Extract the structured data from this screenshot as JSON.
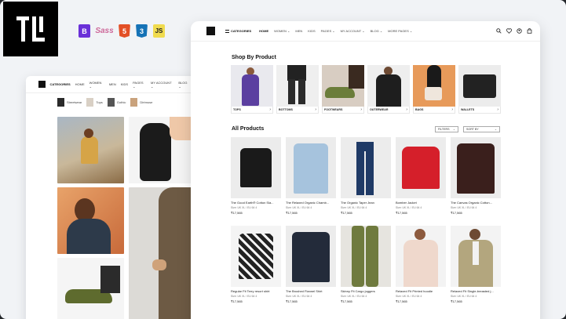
{
  "nav": {
    "categories_label": "CATEGORIES",
    "links": [
      "HOME",
      "WOMEN ⌄",
      "MEN",
      "KIDS",
      "PAGES ⌄",
      "MY ACCOUNT ⌄",
      "BLOG ⌄",
      "MORE PAGES ⌄"
    ],
    "back_links": [
      "HOME",
      "WOMEN ⌄",
      "MEN",
      "KIDS",
      "PAGES ⌄",
      "MY ACCOUNT ⌄",
      "BLOG ⌄",
      "MORE P"
    ]
  },
  "tech_badges": [
    "B",
    "Sass",
    "5",
    "3",
    "JS"
  ],
  "back_categories": [
    "Streetwear",
    "Tops",
    "Gothic",
    "Dirtmuse"
  ],
  "shop_by_product": {
    "title": "Shop By Product",
    "items": [
      {
        "label": "TOPS",
        "color": "#5b3fa0"
      },
      {
        "label": "BOTTOMS",
        "color": "#2b2b2b"
      },
      {
        "label": "FOOTWEARS",
        "color": "#6b7d3a"
      },
      {
        "label": "OUTERWEAR",
        "color": "#1e1e1e"
      },
      {
        "label": "BAGS",
        "color": "#9b5a3a"
      },
      {
        "label": "WALLETS",
        "color": "#222222"
      }
    ]
  },
  "all_products": {
    "title": "All Products",
    "filters_label": "FILTERS",
    "sort_label": "SORT BY",
    "items": [
      {
        "name": "The Good Earth® Cotton Sla...",
        "size": "Size: UK XL / EU 64 4",
        "price": "₹17,565",
        "color": "#1a1a1a"
      },
      {
        "name": "The Relaxed Organic Chamb...",
        "size": "Size: UK XL / EU 64 4",
        "price": "₹17,565",
        "color": "#a6c3dd"
      },
      {
        "name": "The Organic Taper Jean",
        "size": "Size: UK XL / EU 64 4",
        "price": "₹17,565",
        "color": "#1f3a66"
      },
      {
        "name": "Bomber Jacket",
        "size": "Size: UK XL / EU 64 4",
        "price": "₹17,565",
        "color": "#d51f2a"
      },
      {
        "name": "The Canvas Organic Cotton...",
        "size": "Size: UK XL / EU 64 4",
        "price": "₹17,565",
        "color": "#3a1f1c"
      },
      {
        "name": "Regular Fit Terry resort shirt",
        "size": "Size: UK XL / EU 64 4",
        "price": "₹17,565",
        "color": "#222222"
      },
      {
        "name": "The Brushed Flannel Shirt",
        "size": "Size: UK XL / EU 64 4",
        "price": "₹17,565",
        "color": "#232b3a"
      },
      {
        "name": "Skinny Fit Cargo joggers",
        "size": "Size: UK XL / EU 64 4",
        "price": "₹17,565",
        "color": "#6f7a3e"
      },
      {
        "name": "Relaxed Fit Printed hoodie",
        "size": "Size: UK XL / EU 64 4",
        "price": "₹17,565",
        "color": "#efd8cc"
      },
      {
        "name": "Relaxed Fit Single-breasted j...",
        "size": "Size: UK XL / EU 64 4",
        "price": "₹17,565",
        "color": "#b3a67e"
      }
    ]
  }
}
